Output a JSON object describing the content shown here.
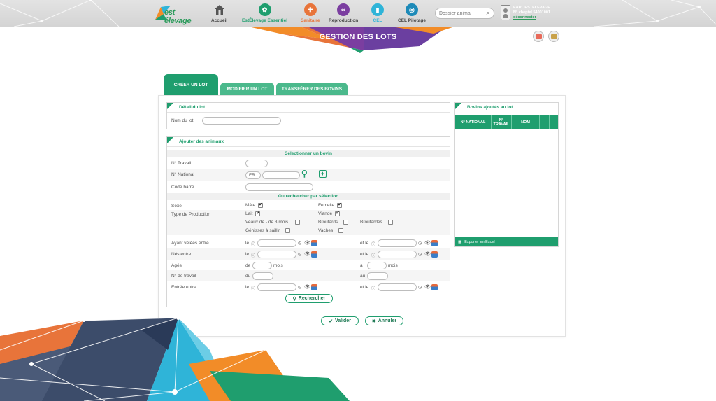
{
  "header": {
    "logo_text": "est élevage",
    "nav": [
      {
        "label": "Accueil",
        "icon": "home-icon",
        "color": "#555555",
        "label_color": "#444444"
      },
      {
        "label": "EstÉlevage Essentiel",
        "icon": "leaf-icon",
        "color": "#1f9e6e",
        "label_color": "#1f9e6e"
      },
      {
        "label": "Sanitaire",
        "icon": "cross-icon",
        "color": "#e8743a",
        "label_color": "#e8743a"
      },
      {
        "label": "Reproduction",
        "icon": "link-icon",
        "color": "#7b3ea0",
        "label_color": "#444444"
      },
      {
        "label": "CEL",
        "icon": "tube-icon",
        "color": "#2fb4d8",
        "label_color": "#2fb4d8"
      },
      {
        "label": "CEL Pilotage",
        "icon": "globe-icon",
        "color": "#1d8ab8",
        "label_color": "#444444"
      }
    ],
    "search_placeholder": "Dossier animal",
    "user": {
      "line1": "EARL ESTELEVAGE",
      "line2": "N° cheptel 54001001",
      "logout": "déconnecter"
    }
  },
  "page": {
    "title": "GESTION DES LOTS"
  },
  "tabs": [
    {
      "label": "CRÉER UN LOT",
      "active": true
    },
    {
      "label": "MODIFIER UN LOT",
      "active": false
    },
    {
      "label": "TRANSFÉRER DES BOVINS",
      "active": false
    }
  ],
  "detail": {
    "title": "Détail du lot",
    "nom_label": "Nom du lot",
    "nom_value": ""
  },
  "ajouter": {
    "title": "Ajouter des animaux",
    "select_head": "Sélectionner un bovin",
    "travail_label": "N° Travail",
    "national_label": "N° National",
    "national_prefix": "FR",
    "codebarre_label": "Code barre",
    "search_head": "Ou rechercher par sélection",
    "sexe_label": "Sexe",
    "male": "Mâle",
    "femelle": "Femelle",
    "typeprod_label": "Type de Production",
    "lait": "Lait",
    "viande": "Viande",
    "veaux": "Veaux de - de 3 mois",
    "broutards1": "Broutards",
    "broutardes": "Broutardes",
    "genisses": "Génisses à saillir",
    "vaches": "Vaches",
    "velees_label": "Ayant vêlées entre",
    "nes_label": "Nés entre",
    "ages_label": "Agés",
    "travail2_label": "N° de travail",
    "entree_label": "Entrée entre",
    "le": "le",
    "et_le": "et le",
    "de": "de",
    "mois": "mois",
    "a": "à",
    "du": "du",
    "au": "au",
    "rechercher": "Rechercher"
  },
  "bovins": {
    "title": "Bovins ajoutés au lot",
    "columns": [
      "N° NATIONAL",
      "N° TRAVAIL",
      "NOM"
    ],
    "export": "Exporter en Excel"
  },
  "actions": {
    "valider": "Valider",
    "annuler": "Annuler"
  },
  "colors": {
    "accent": "#1f9e6e",
    "tab_inactive": "#4bb98c"
  }
}
